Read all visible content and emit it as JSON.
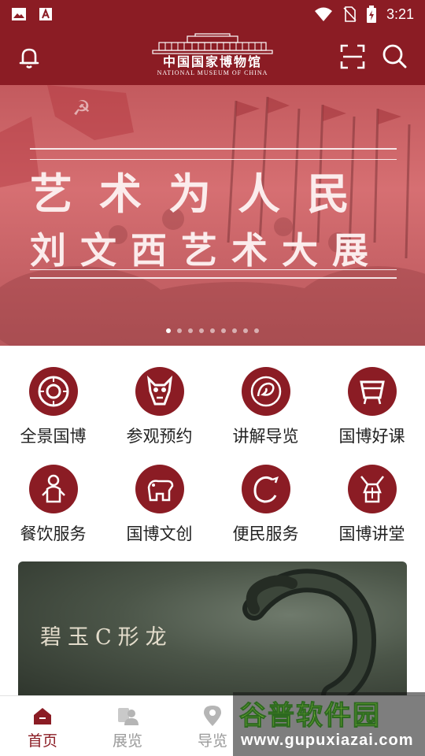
{
  "status_bar": {
    "time": "3:21"
  },
  "header": {
    "logo_cn": "中国国家博物馆",
    "logo_en": "NATIONAL MUSEUM OF CHINA"
  },
  "banner": {
    "title_line1": "艺术为人民",
    "title_line2": "刘文西艺术大展",
    "slide_count": 9,
    "active_slide": 1
  },
  "grid": [
    {
      "label": "全景国博",
      "icon": "jade-disc-icon"
    },
    {
      "label": "参观预约",
      "icon": "bronze-mask-icon"
    },
    {
      "label": "讲解导览",
      "icon": "phoenix-icon"
    },
    {
      "label": "国博好课",
      "icon": "bronze-vessel-icon"
    },
    {
      "label": "餐饮服务",
      "icon": "figurine-icon"
    },
    {
      "label": "国博文创",
      "icon": "rhino-vessel-icon"
    },
    {
      "label": "便民服务",
      "icon": "c-dragon-icon"
    },
    {
      "label": "国博讲堂",
      "icon": "zun-vessel-icon"
    }
  ],
  "feature": {
    "title": "碧玉C形龙"
  },
  "bottom_nav": [
    {
      "label": "首页",
      "icon": "home-icon",
      "active": true
    },
    {
      "label": "展览",
      "icon": "exhibition-icon",
      "active": false
    },
    {
      "label": "导览",
      "icon": "location-icon",
      "active": false
    },
    {
      "label": "",
      "icon": "nav-icon-4",
      "active": false
    },
    {
      "label": "",
      "icon": "nav-icon-5",
      "active": false
    }
  ],
  "watermark": {
    "title": "谷普软件园",
    "url": "www.gupuxiazai.com"
  },
  "colors": {
    "brand": "#8b1c24",
    "banner": "#c9656a",
    "feature": "#4b5548"
  }
}
